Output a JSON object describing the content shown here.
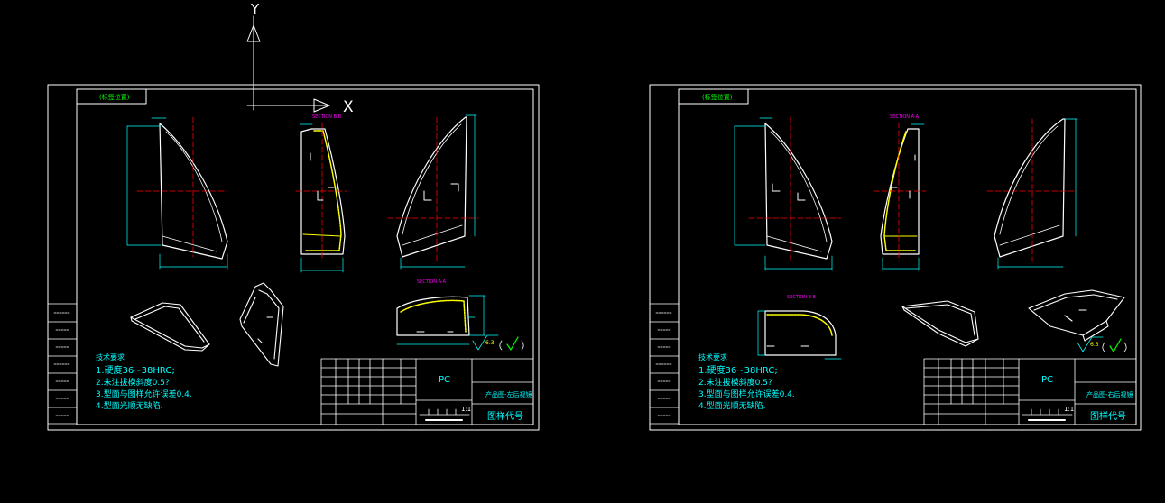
{
  "ucs": {
    "y_label": "Y",
    "x_label": "X"
  },
  "colors": {
    "background": "#000000",
    "frame": "#ffffff",
    "cyan": "#00ffff",
    "yellow": "#ffff00",
    "red": "#ff0000",
    "green": "#00ff00",
    "magenta": "#ff00ff"
  },
  "sheets": [
    {
      "title_tag": "(标签位置)",
      "section_label_1": "SECTION B-B",
      "section_label_2": "SECTION A-A",
      "notes_heading": "技术要求",
      "notes": [
        "1.硬度36~38HRC;",
        "2.未注拔模斜度0.5?",
        "3.型面与图样允许误差0.4.",
        "4.型面光顺无缺陷."
      ],
      "material": "PC",
      "product_name": "产品图-左后视镜",
      "drawing_no_label": "图样代号",
      "scale": "1:1",
      "roughness_value": "6.3"
    },
    {
      "title_tag": "(标签位置)",
      "section_label_1": "SECTION A-A",
      "section_label_2": "SECTION B-B",
      "notes_heading": "技术要求",
      "notes": [
        "1.硬度36~38HRC;",
        "2.未注拔模斜度0.5?",
        "3.型面与图样允许误差0.4.",
        "4.型面光顺无缺陷."
      ],
      "material": "PC",
      "product_name": "产品图-右后视镜",
      "drawing_no_label": "图样代号",
      "scale": "1:1",
      "roughness_value": "6.3"
    }
  ]
}
